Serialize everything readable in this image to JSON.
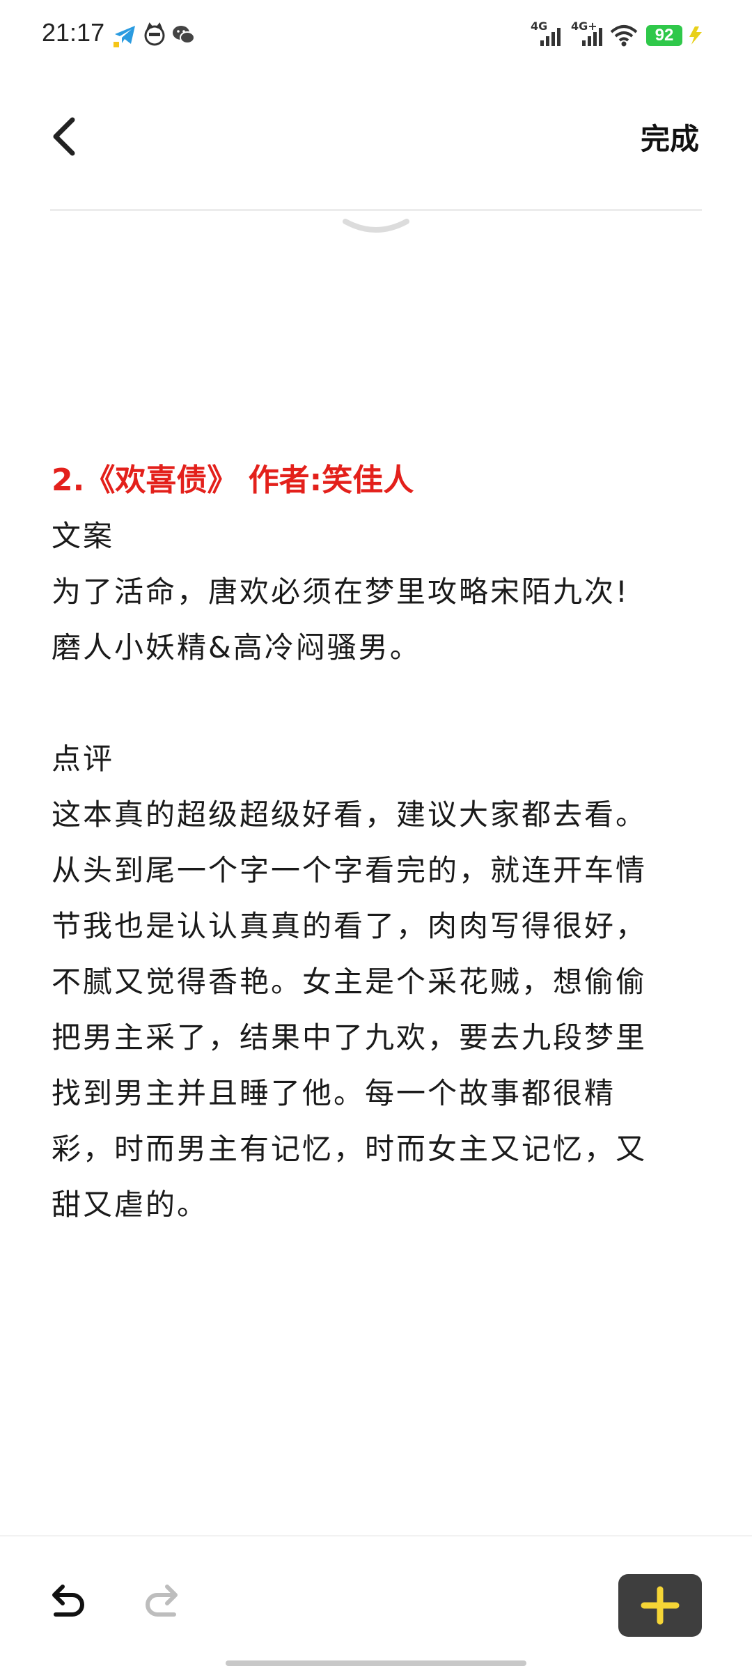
{
  "status_bar": {
    "time": "21:17",
    "notification_icons": [
      "telegram-icon",
      "cat-app-icon",
      "wechat-icon"
    ],
    "signal_1_label": "4G",
    "signal_2_label": "4G+",
    "battery_level": "92",
    "colors": {
      "battery_fill": "#2fc84a",
      "charging_bolt": "#e8d01a"
    }
  },
  "toolbar": {
    "back_icon": "chevron-left-icon",
    "done_label": "完成"
  },
  "note": {
    "heading": "2.《欢喜债》 作者:笑佳人",
    "heading_color": "#e3201b",
    "lines": [
      "文案",
      "为了活命，唐欢必须在梦里攻略宋陌九次!",
      "磨人小妖精&高冷闷骚男。",
      "",
      "点评",
      "这本真的超级超级好看，建议大家都去看。",
      "从头到尾一个字一个字看完的，就连开车情",
      "节我也是认认真真的看了，肉肉写得很好，",
      "不腻又觉得香艳。女主是个采花贼，想偷偷",
      "把男主采了，结果中了九欢，要去九段梦里",
      "找到男主并且睡了他。每一个故事都很精",
      "彩，时而男主有记忆，时而女主又记忆，又",
      "甜又虐的。"
    ]
  },
  "bottom_bar": {
    "undo_icon": "undo-icon",
    "redo_icon": "redo-icon",
    "add_icon": "plus-icon",
    "colors": {
      "add_button_bg": "#3e3e3e",
      "plus_color": "#f5d536"
    }
  }
}
